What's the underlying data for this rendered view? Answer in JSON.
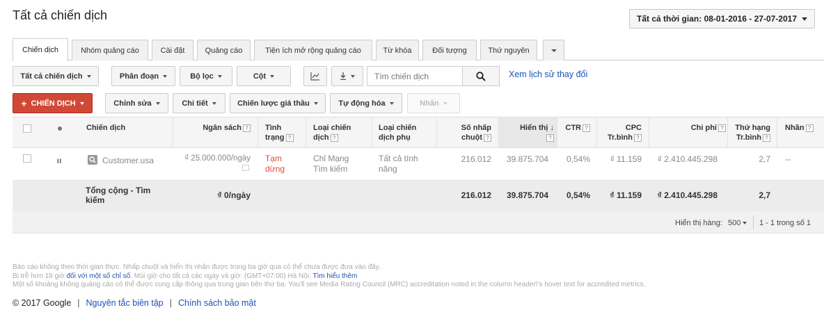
{
  "page": {
    "title": "Tất cả chiến dịch"
  },
  "date_range": {
    "label": "Tất cả thời gian:",
    "value": "08-01-2016 - 27-07-2017"
  },
  "tabs": [
    {
      "label": "Chiến dịch",
      "active": true
    },
    {
      "label": "Nhóm quảng cáo"
    },
    {
      "label": "Cài đặt"
    },
    {
      "label": "Quảng cáo"
    },
    {
      "label": "Tiện ích mở rộng quảng cáo"
    },
    {
      "label": "Từ khóa"
    },
    {
      "label": "Đối tượng"
    },
    {
      "label": "Thứ nguyên"
    }
  ],
  "toolbar": {
    "all_campaigns": "Tất cả chiến dịch",
    "segment": "Phân đoạn",
    "filter": "Bộ lọc",
    "columns": "Cột",
    "search_placeholder": "Tìm chiến dịch",
    "history_link": "Xem lịch sử thay đổi",
    "new_campaign": "CHIẾN DỊCH",
    "edit": "Chỉnh sửa",
    "details": "Chi tiết",
    "bid_strategy": "Chiến lược giá thầu",
    "automate": "Tự động hóa",
    "labels": "Nhãn"
  },
  "table": {
    "headers": {
      "campaign": "Chiến dịch",
      "budget": "Ngân sách",
      "status_1": "Tình",
      "status_2": "trạng",
      "type_1": "Loại chiến",
      "type_2": "dịch",
      "subtype_1": "Loại chiến",
      "subtype_2": "dịch phụ",
      "clicks_1": "Số nhấp",
      "clicks_2": "chuột",
      "impr": "Hiển thị",
      "ctr": "CTR",
      "cpc_1": "CPC",
      "cpc_2": "Tr.bình",
      "cost": "Chi phí",
      "rank_1": "Thứ hạng",
      "rank_2": "Tr.bình",
      "labels": "Nhãn"
    },
    "row": {
      "campaign": "Customer.usa",
      "budget": "₫ 25.000.000/ngày",
      "status_1": "Tạm",
      "status_2": "dừng",
      "type_1": "Chỉ Mạng",
      "type_2": "Tìm kiếm",
      "subtype_1": "Tất cả tính",
      "subtype_2": "năng",
      "clicks": "216.012",
      "impr": "39.875.704",
      "ctr": "0,54%",
      "cpc": "₫ 11.159",
      "cost": "₫ 2.410.445.298",
      "rank": "2,7",
      "labels": "--"
    },
    "total": {
      "label_1": "Tổng cộng - Tìm",
      "label_2": "kiếm",
      "budget": "₫ 0/ngày",
      "clicks": "216.012",
      "impr": "39.875.704",
      "ctr": "0,54%",
      "cpc": "₫ 11.159",
      "cost": "₫ 2.410.445.298",
      "rank": "2,7"
    },
    "footer": {
      "rows_label": "Hiển thị hàng:",
      "rows_value": "500",
      "range": "1 - 1 trong số 1"
    }
  },
  "notes": {
    "line1": "Báo cáo không theo thời gian thực. Nhấp chuột và hiển thị nhận được trong ba giờ qua có thể chưa được đưa vào đây.",
    "line2_a": "Bị trễ hơn 18 giờ",
    "line2_link1": "đối với một số chỉ số",
    "line2_b": ". Múi giờ cho tất cả các ngày và giờ: (GMT+07:00) Hà Nội.",
    "line2_link2": "Tìm hiểu thêm",
    "line3": "Một số khoảng không quảng cáo có thể được cung cấp thông qua trung gian bên thứ ba. You'll see Media Rating Council (MRC) accreditation noted in the column header\\'s hover text for accredited metrics."
  },
  "footer": {
    "copyright": "© 2017 Google",
    "editorial": "Nguyên tắc biên tập",
    "privacy": "Chính sách bảo mật"
  },
  "colors": {
    "accent_red": "#d14836",
    "link_blue": "#1a53b4",
    "paused_red": "#dd4b39"
  }
}
